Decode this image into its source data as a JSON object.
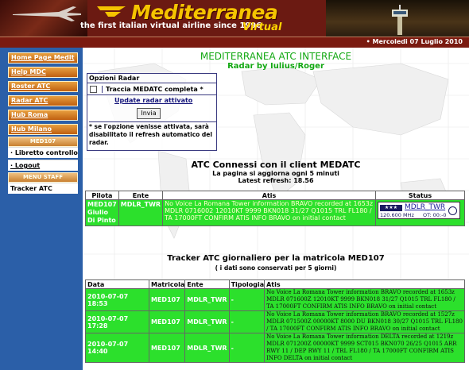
{
  "header": {
    "title": "Mediterranea",
    "subtitle": "Virtual",
    "tagline": "the first italian virtual airline since 1996",
    "date": "• Mercoledi 07 Luglio 2010"
  },
  "sidebar": {
    "items": [
      {
        "label": "Home Page Medit"
      },
      {
        "label": "Help MDC"
      },
      {
        "label": "Roster ATC"
      },
      {
        "label": "Radar ATC"
      },
      {
        "label": "Hub Roma"
      },
      {
        "label": "Hub Milano"
      },
      {
        "label": "MED107"
      },
      {
        "label": "· Libretto controllo"
      },
      {
        "label": "· Logout"
      },
      {
        "label": "MENU STAFF"
      },
      {
        "label": "Tracker ATC"
      }
    ]
  },
  "main": {
    "title": "MEDITERRANEA ATC INTERFACE",
    "subtitle": "Radar by Iulius/Roger",
    "radar_form": {
      "legend": "Opzioni Radar",
      "checkbox_label": "Traccia MEDATC completa *",
      "status_text": "Update radar attivato",
      "submit_label": "Invia",
      "note": "* se l'opzione venisse attivata, sarà disabilitato il refresh automatico del radar."
    },
    "connected": {
      "title": "ATC Connessi con il client MEDATC",
      "refresh_note": "La pagina si aggiorna ogni 5 minuti",
      "latest_refresh": "Latest refresh: 18.56",
      "headers": [
        "Pilota",
        "Ente",
        "Atis",
        "Status"
      ],
      "rows": [
        {
          "pilota": "MED107 Giulio Di Pinto",
          "ente": "MDLR_TWR",
          "atis": "No Voice La Romana Tower information BRAVO recorded at 1653z MDLR 0716002 12010KT 9999 BKN018 31/27 Q1015 TRL FL180 / TA 17000FT CONFIRM ATIS INFO BRAVO on initial contact",
          "status": {
            "badge": "★★★",
            "callsign": "MDLR_TWR",
            "freq": "120.600 MHz",
            "ot": "OT: 00:-0"
          }
        }
      ]
    },
    "tracker": {
      "title": "Tracker ATC giornaliero per la matricola MED107",
      "note": "( i dati sono conservati per 5 giorni)",
      "headers": [
        "Data",
        "Matricola",
        "Ente",
        "Tipologia",
        "Atis"
      ],
      "rows": [
        {
          "data": "2010-07-07 18:53",
          "matricola": "MED107",
          "ente": "MDLR_TWR",
          "tipologia": "-",
          "atis": "No Voice La Romana Tower information BRAVO recorded at 1653z MDLR 071600Z 12010KT 9999 BKN018 31/27 Q1015 TRL FL180 / TA 17000FT CONFIRM ATIS INFO BRAVO on initial contact"
        },
        {
          "data": "2010-07-07 17:28",
          "matricola": "MED107",
          "ente": "MDLR_TWR",
          "tipologia": "-",
          "atis": "No Voice La Romana Tower information BRAVO recorded at 1527z MDLR 071500Z 00000KT 8000 DU BKN018 30/27 Q1015 TRL FL180 / TA 17000FT CONFIRM ATIS INFO BRAVO on initial contact"
        },
        {
          "data": "2010-07-07 14:40",
          "matricola": "MED107",
          "ente": "MDLR_TWR",
          "tipologia": "-",
          "atis": "No Voice La Romana Tower information DELTA recorded at 1219z MDLR 071200Z 00000KT 9999 SCT015 BKN070 26/25 Q1015 ARR RWY 11 / DEP RWY 11 / TRL FL180 / TA 17000FT CONFIRM ATIS INFO DELTA on initial contact"
        }
      ]
    }
  },
  "colors": {
    "header_bg": "#6b1a12",
    "title_yellow": "#f5c400",
    "sidebar_bg": "#2b5fa8",
    "menu_orange": "#c06010",
    "heading_green": "#13a813",
    "row_green": "#2ce02c"
  }
}
